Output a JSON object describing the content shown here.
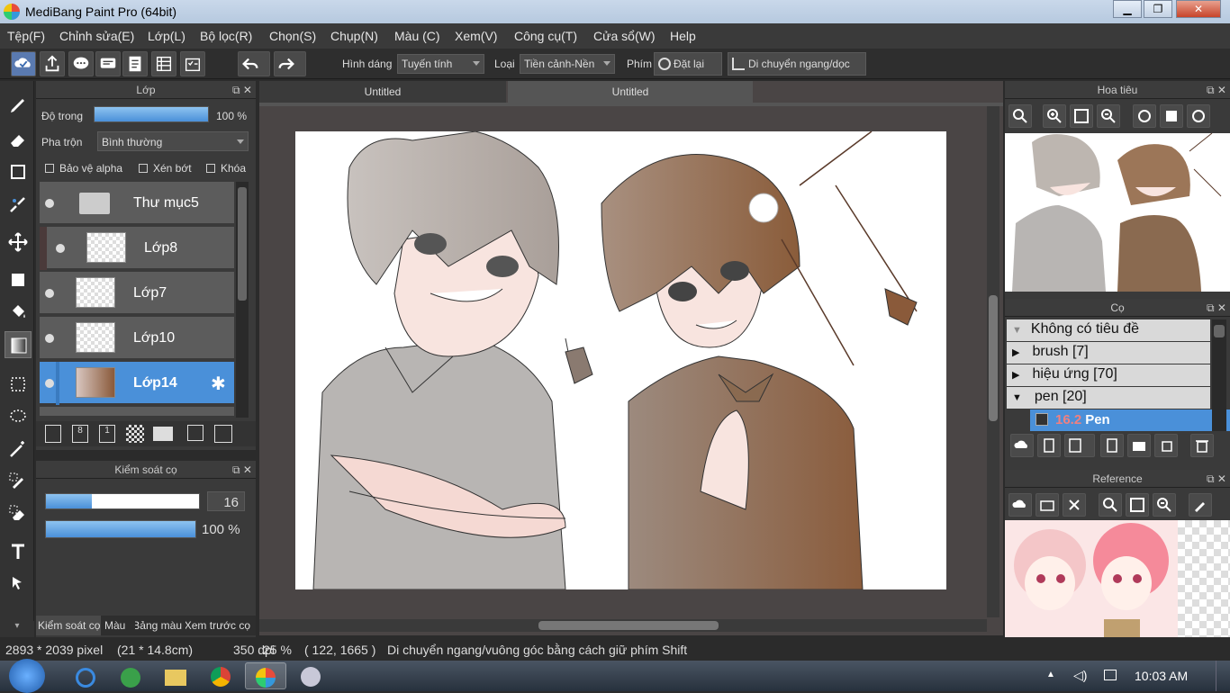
{
  "window": {
    "title": "MediBang Paint Pro (64bit)",
    "minimize": "▁",
    "maximize": "❐",
    "close": "✕"
  },
  "menu": [
    "Tệp(F)",
    "Chỉnh sửa(E)",
    "Lớp(L)",
    "Bộ lọc(R)",
    "Chọn(S)",
    "Chụp(N)",
    "Màu (C)",
    "Xem(V)",
    "Công cụ(T)",
    "Cửa sổ(W)",
    "Help"
  ],
  "toolbar": {
    "shape_label": "Hình dáng",
    "shape_value": "Tuyến tính",
    "type_label": "Loại",
    "type_value": "Tiền cảnh-Nền",
    "key_label": "Phím",
    "reset_label": "Đặt lại",
    "move_label": "Di chuyển ngang/dọc"
  },
  "layer_panel": {
    "title": "Lớp",
    "opacity_label": "Độ trong",
    "opacity_value": "100 %",
    "opacity": 1.0,
    "blend_label": "Pha trộn",
    "blend_value": "Bình thường",
    "protect_alpha": "Bảo vệ alpha",
    "clipping": "Xén bớt",
    "lock": "Khóa",
    "layers": [
      {
        "name": "Thư mục5",
        "type": "folder"
      },
      {
        "name": "Lớp8",
        "type": "layer"
      },
      {
        "name": "Lớp7",
        "type": "layer"
      },
      {
        "name": "Lớp10",
        "type": "layer"
      },
      {
        "name": "Lớp14",
        "type": "layer",
        "selected": true
      }
    ]
  },
  "brush_control": {
    "title": "Kiểm soát cọ",
    "size_value": "16",
    "size_fill": 0.3,
    "opacity_value": "100 %",
    "opacity_fill": 1.0
  },
  "bottom_tabs": [
    "Kiểm soát cọ",
    "Màu",
    "Bảng màu",
    "Xem trước cọ"
  ],
  "document_tabs": [
    "Untitled",
    "Untitled"
  ],
  "navigator": {
    "title": "Hoa tiêu"
  },
  "brush_panel": {
    "title": "Cọ",
    "items": [
      {
        "label": "Không có tiêu đề",
        "arrow": "▼"
      },
      {
        "label": "brush [7]",
        "arrow": "▶"
      },
      {
        "label": "hiệu ứng [70]",
        "arrow": "▶"
      },
      {
        "label": "pen [20]",
        "arrow": "▼"
      }
    ],
    "selected_size": "16.2",
    "selected_name": "Pen"
  },
  "reference": {
    "title": "Reference"
  },
  "status": {
    "size": "2893 * 2039 pixel",
    "cm": "(21 * 14.8cm)",
    "dpi": "350 dpi",
    "zoom": "25 %",
    "coords": "( 122, 1665 )",
    "hint": "Di chuyển ngang/vuông góc bằng cách giữ phím Shift"
  },
  "taskbar": {
    "time": "10:03 AM"
  },
  "colors": {
    "accent": "#4a90d9",
    "panel": "#3a3a3a",
    "canvas_bg": "#4a4545"
  }
}
